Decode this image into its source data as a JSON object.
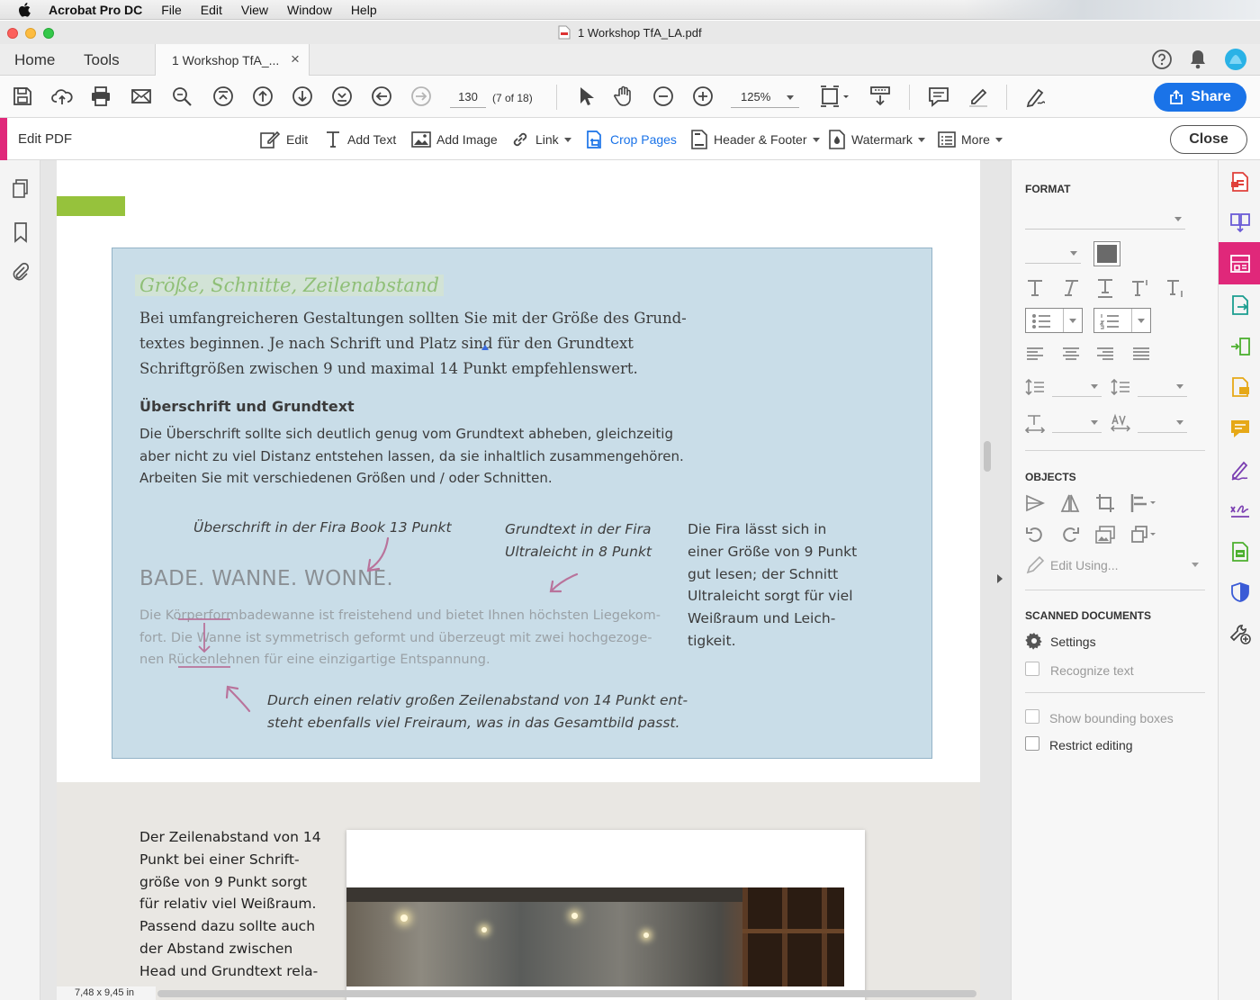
{
  "menubar": {
    "app": "Acrobat Pro DC",
    "items": [
      "File",
      "Edit",
      "View",
      "Window",
      "Help"
    ]
  },
  "window": {
    "title": "1  Workshop TfA_LA.pdf"
  },
  "tabs": {
    "home": "Home",
    "tools": "Tools",
    "doc": "1  Workshop TfA_...",
    "doc_close": "×"
  },
  "toolbar": {
    "page_number": "130",
    "page_of": "(7 of 18)",
    "zoom": "125%",
    "share": "Share"
  },
  "editbar": {
    "title": "Edit PDF",
    "edit": "Edit",
    "add_text": "Add Text",
    "add_image": "Add Image",
    "link": "Link",
    "crop_pages": "Crop Pages",
    "header_footer": "Header & Footer",
    "watermark": "Watermark",
    "more": "More",
    "close": "Close"
  },
  "page": {
    "heading": "Größe, Schnitte, Zeilenabstand",
    "intro_lines": [
      "Bei umfangreicheren Gestaltungen sollten Sie mit der Größe des Grund-",
      "textes beginnen. Je nach Schrift und Platz sind für den Grundtext",
      "Schriftgrößen zwischen 9 und maximal 14 Punkt empfehlenswert."
    ],
    "subheading": "Überschrift und Grundtext",
    "body_lines": [
      "Die Überschrift sollte sich deutlich genug vom Grundtext abheben, gleichzeitig",
      "aber nicht zu viel Distanz entstehen lassen, da sie inhaltlich zusammengehören.",
      "Arbeiten Sie mit verschiedenen Größen und / oder Schnitten."
    ],
    "note_headline": "Überschrift in der Fira Book 13 Punkt",
    "note_body_lines": [
      "Grundtext in der Fira",
      "Ultraleicht in 8 Punkt"
    ],
    "sample_headline": "BADE. WANNE. WONNE.",
    "sample_body_lines": [
      "Die Körperformbadewanne ist freistehend und bietet Ihnen höchsten Liegekom-",
      "fort. Die Wanne ist symmetrisch geformt und überzeugt mit zwei hochgezoge-",
      "nen Rückenlehnen für eine einzigartige Entspannung."
    ],
    "side_lines": [
      "Die Fira lässt sich in",
      "einer Größe von 9 Punkt",
      "gut lesen; der Schnitt",
      "Ultraleicht sorgt für viel",
      "Weißraum und Leich-",
      "tigkeit."
    ],
    "note_spacing_lines": [
      "Durch einen relativ großen Zeilenabstand von 14 Punkt ent-",
      "steht ebenfalls viel Freiraum, was in das Gesamtbild passt."
    ],
    "bottom_lines": [
      "Der Zeilenabstand von 14",
      "Punkt bei einer Schrift-",
      "größe von 9 Punkt sorgt",
      "für relativ viel Weißraum.",
      "Passend dazu sollte auch",
      "der Abstand zwischen",
      "Head und Grundtext rela-"
    ],
    "page_size": "7,48 x 9,45 in"
  },
  "rightpanel": {
    "format": "FORMAT",
    "objects": "OBJECTS",
    "edit_using": "Edit Using...",
    "scanned": "SCANNED DOCUMENTS",
    "settings": "Settings",
    "recognize": "Recognize text",
    "bounding": "Show bounding boxes",
    "restrict": "Restrict editing"
  },
  "colors": {
    "accent_pink": "#e0287a",
    "share_blue": "#1a73e8",
    "box_blue": "#c9dde8",
    "green_bar": "#96c23c",
    "arrow_pink": "#b9739b"
  }
}
